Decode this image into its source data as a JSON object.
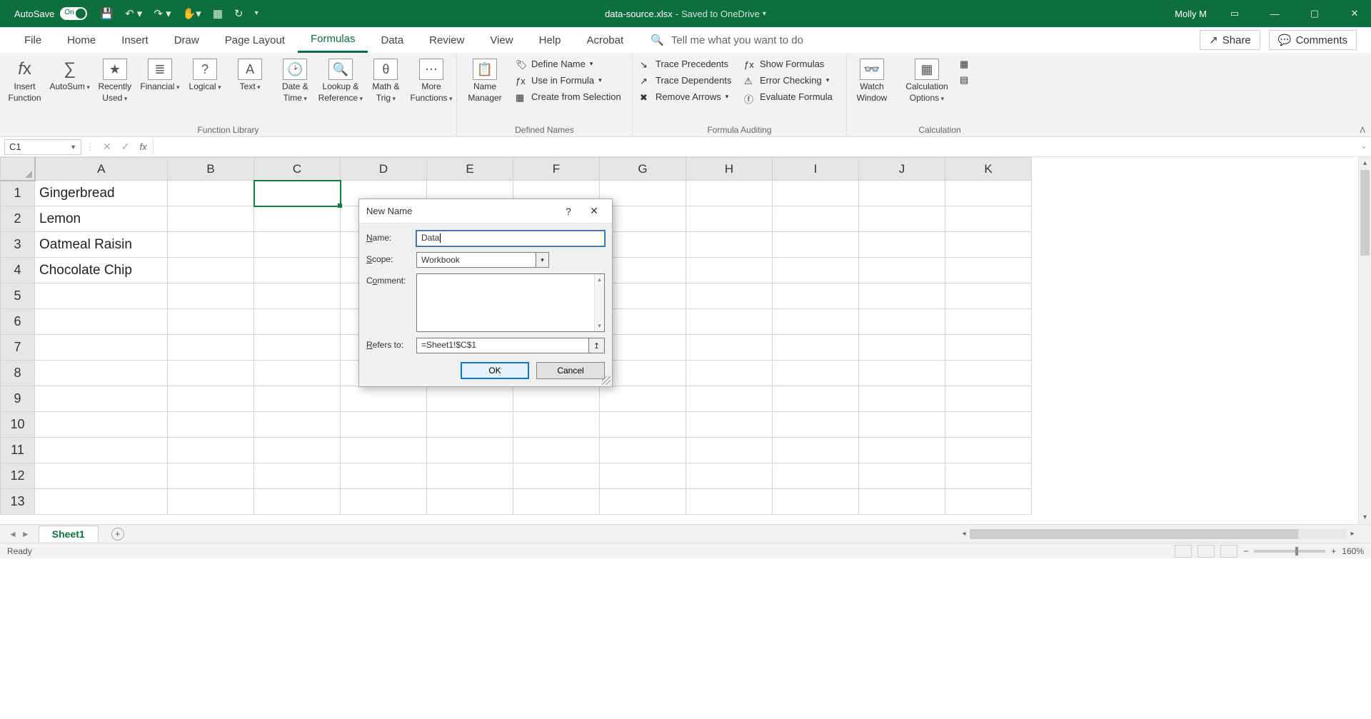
{
  "titlebar": {
    "autosave_label": "AutoSave",
    "autosave_state": "On",
    "doc_name": "data-source.xlsx",
    "saved_status": "Saved to OneDrive",
    "user_name": "Molly M"
  },
  "tabs": {
    "file": "File",
    "home": "Home",
    "insert": "Insert",
    "draw": "Draw",
    "page_layout": "Page Layout",
    "formulas": "Formulas",
    "data": "Data",
    "review": "Review",
    "view": "View",
    "help": "Help",
    "acrobat": "Acrobat",
    "tell_me": "Tell me what you want to do",
    "share": "Share",
    "comments": "Comments"
  },
  "ribbon": {
    "insert_function": "Insert\nFunction",
    "autosum": "AutoSum",
    "recently_used": "Recently\nUsed",
    "financial": "Financial",
    "logical": "Logical",
    "text": "Text",
    "date_time": "Date &\nTime",
    "lookup_ref": "Lookup &\nReference",
    "math_trig": "Math &\nTrig",
    "more_functions": "More\nFunctions",
    "group_function_library": "Function Library",
    "name_manager": "Name\nManager",
    "define_name": "Define Name",
    "use_in_formula": "Use in Formula",
    "create_from_selection": "Create from Selection",
    "group_defined_names": "Defined Names",
    "trace_precedents": "Trace Precedents",
    "trace_dependents": "Trace Dependents",
    "remove_arrows": "Remove Arrows",
    "show_formulas": "Show Formulas",
    "error_checking": "Error Checking",
    "evaluate_formula": "Evaluate Formula",
    "group_formula_auditing": "Formula Auditing",
    "watch_window": "Watch\nWindow",
    "calc_options": "Calculation\nOptions",
    "group_calculation": "Calculation"
  },
  "formula_bar": {
    "name_box": "C1",
    "formula": ""
  },
  "grid": {
    "columns": [
      "A",
      "B",
      "C",
      "D",
      "E",
      "F",
      "G",
      "H",
      "I",
      "J",
      "K"
    ],
    "rows": [
      1,
      2,
      3,
      4,
      5,
      6,
      7,
      8,
      9,
      10,
      11,
      12,
      13
    ],
    "data": {
      "A1": "Gingerbread",
      "A2": "Lemon",
      "A3": "Oatmeal Raisin",
      "A4": "Chocolate Chip"
    },
    "selected": "C1"
  },
  "sheets": {
    "active": "Sheet1"
  },
  "status": {
    "ready": "Ready",
    "zoom": "160%"
  },
  "dialog": {
    "title": "New Name",
    "name_label": "Name:",
    "name_value": "Data",
    "scope_label": "Scope:",
    "scope_value": "Workbook",
    "comment_label": "Comment:",
    "comment_value": "",
    "refers_label": "Refers to:",
    "refers_value": "=Sheet1!$C$1",
    "ok": "OK",
    "cancel": "Cancel"
  }
}
